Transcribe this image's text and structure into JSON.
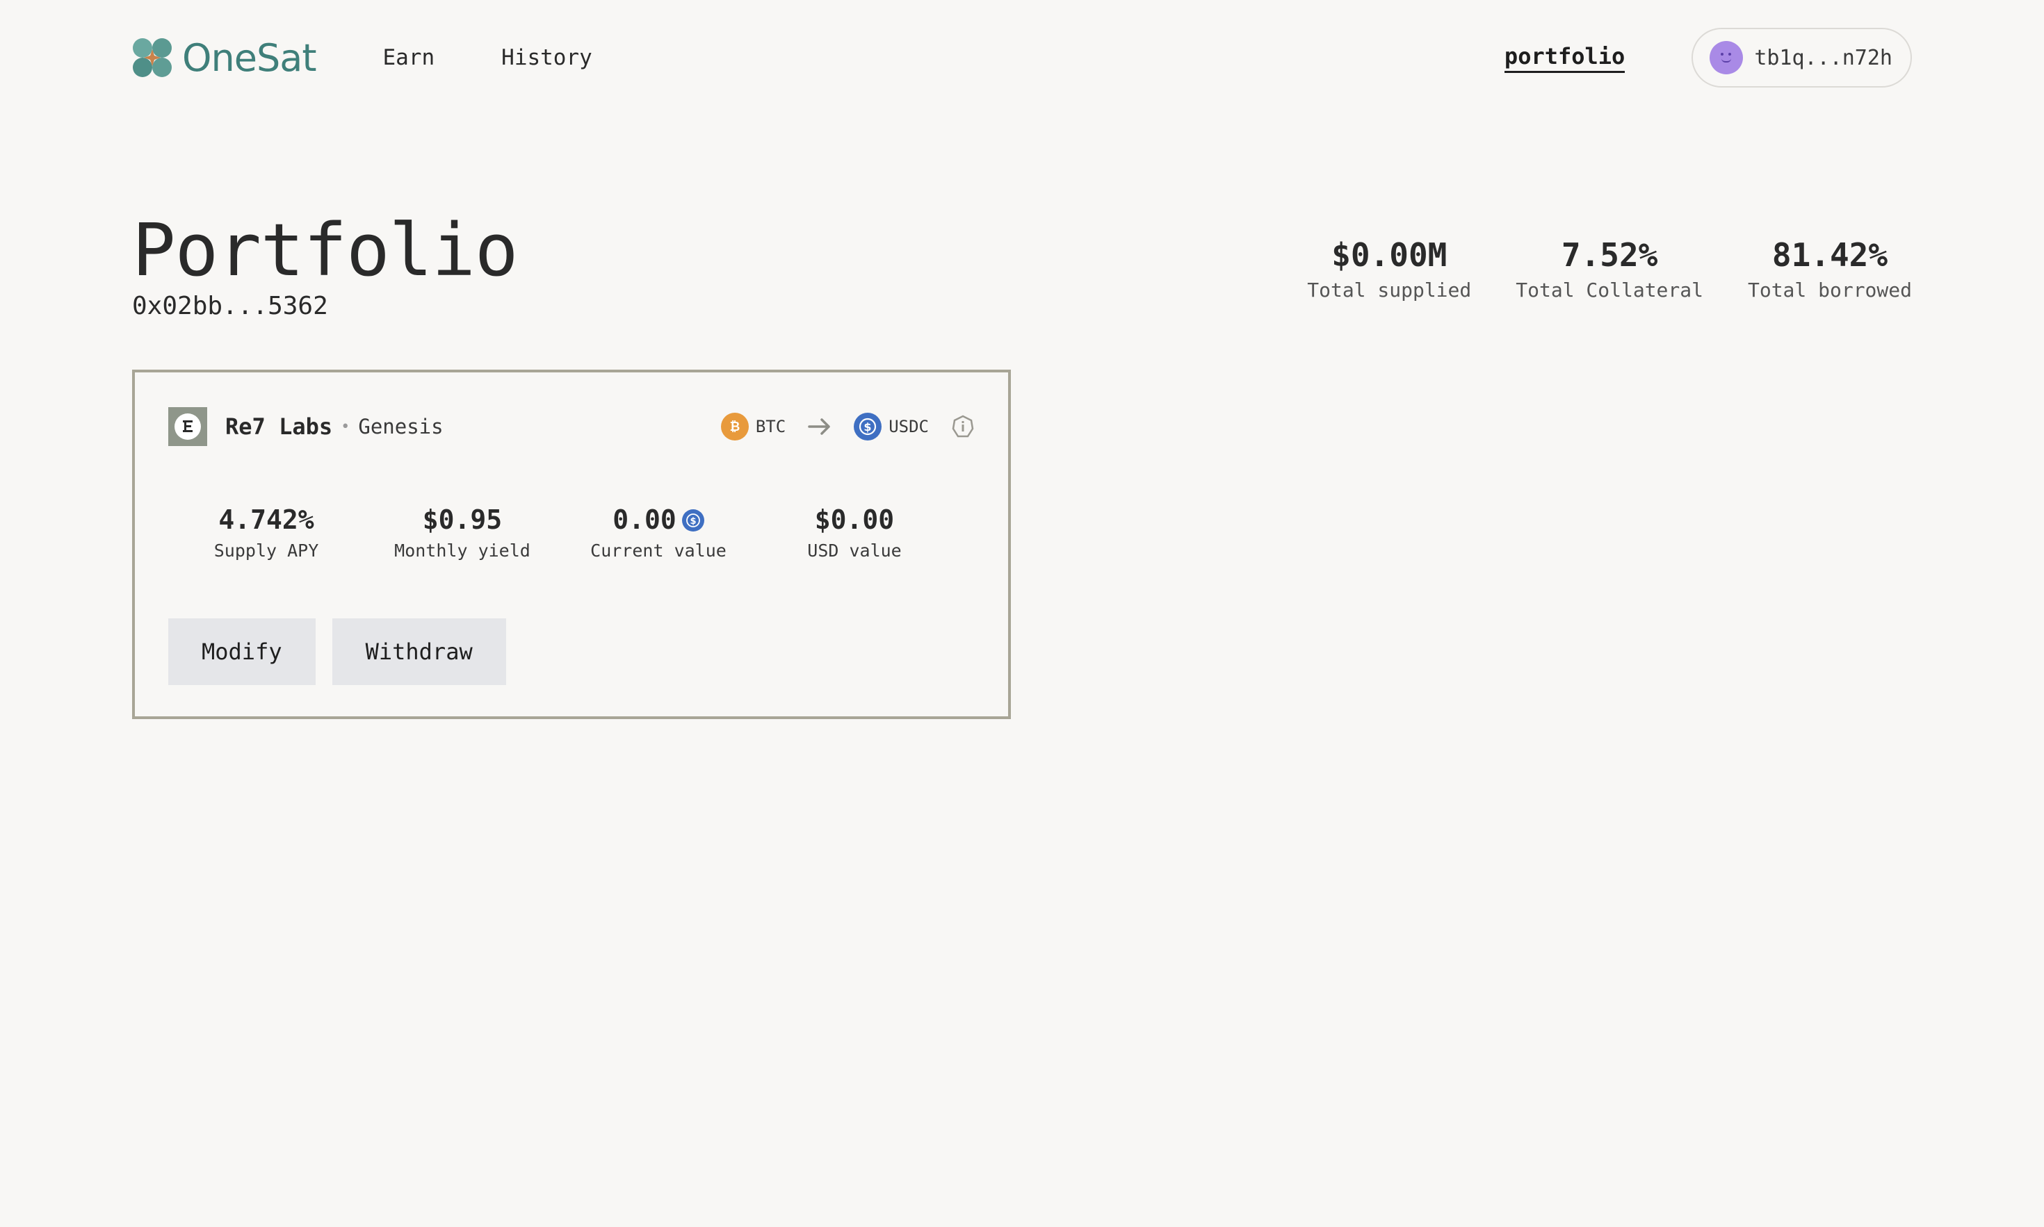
{
  "header": {
    "brand": "OneSat",
    "nav": [
      {
        "label": "Earn"
      },
      {
        "label": "History"
      }
    ],
    "portfolio_link": "portfolio",
    "wallet_address": "tb1q...n72h"
  },
  "page": {
    "title": "Portfolio",
    "address": "0x02bb...5362"
  },
  "stats": [
    {
      "value": "$0.00M",
      "label": "Total supplied"
    },
    {
      "value": "7.52%",
      "label": "Total Collateral"
    },
    {
      "value": "81.42%",
      "label": "Total borrowed"
    }
  ],
  "position": {
    "vault_name": "Re7 Labs",
    "vault_tag": "Genesis",
    "collateral_asset": "BTC",
    "loan_asset": "USDC",
    "metrics": [
      {
        "value": "4.742%",
        "label": "Supply APY"
      },
      {
        "value": "$0.95",
        "label": "Monthly yield"
      },
      {
        "value": "0.00",
        "label": "Current value"
      },
      {
        "value": "$0.00",
        "label": "USD value"
      }
    ],
    "actions": {
      "modify": "Modify",
      "withdraw": "Withdraw"
    }
  },
  "colors": {
    "background": "#f8f7f5",
    "brand": "#3f7f7a",
    "btc": "#e89a3c",
    "usdc": "#3f6fc2",
    "card_border": "#a8a596",
    "button_bg": "#e5e6e9",
    "avatar": "#a98ae6"
  },
  "icons": {
    "logo": "four-petal-logo",
    "btc": "bitcoin-icon",
    "usdc": "usdc-icon",
    "arrow": "arrow-right-icon",
    "info": "info-icon",
    "vault": "vault-logo-icon"
  }
}
